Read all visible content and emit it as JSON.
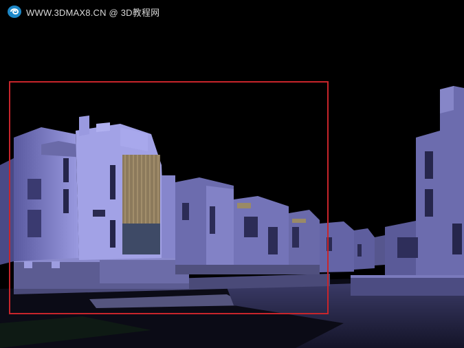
{
  "watermark": {
    "text": "WWW.3DMAX8.CN @ 3D教程网",
    "logo_icon": "spiral-logo-icon"
  },
  "render_frame": {
    "color": "#c8252b"
  },
  "scene": {
    "facade_light": "#8f8fd6",
    "facade_mid": "#6f6fb4",
    "facade_dark": "#3c3c72",
    "ground": "#2b2b4e",
    "sky": "#000000"
  }
}
